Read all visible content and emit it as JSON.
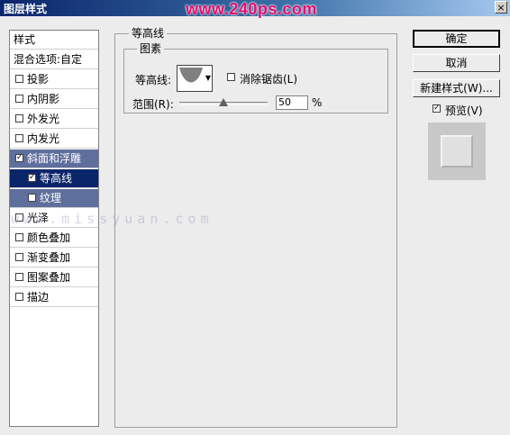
{
  "window": {
    "title": "图层样式",
    "watermark": "www.240ps.com",
    "close_glyph": "×"
  },
  "sidebar": {
    "header1": "样式",
    "header2": "混合选项:自定",
    "items": [
      {
        "label": "投影",
        "checked": false
      },
      {
        "label": "内阴影",
        "checked": false
      },
      {
        "label": "外发光",
        "checked": false
      },
      {
        "label": "内发光",
        "checked": false
      },
      {
        "label": "斜面和浮雕",
        "checked": true
      },
      {
        "label": "等高线",
        "checked": true
      },
      {
        "label": "纹理",
        "checked": false
      },
      {
        "label": "光泽",
        "checked": false
      },
      {
        "label": "颜色叠加",
        "checked": false
      },
      {
        "label": "渐变叠加",
        "checked": false
      },
      {
        "label": "图案叠加",
        "checked": false
      },
      {
        "label": "描边",
        "checked": false
      }
    ]
  },
  "panel": {
    "section_title": "等高线",
    "group_title": "图素",
    "contour_label": "等高线:",
    "antialias_label": "消除锯齿(L)",
    "antialias_checked": false,
    "range_label": "范围(R):",
    "range_value": "50",
    "range_unit": "%"
  },
  "buttons": {
    "ok": "确定",
    "cancel": "取消",
    "new_style": "新建样式(W)..."
  },
  "preview": {
    "label": "预览(V)",
    "checked": true
  },
  "overlay_watermark": "www.missyuan.com",
  "icons": {
    "check": "check-icon",
    "dropdown": "dropdown-arrow-icon",
    "close": "close-icon"
  }
}
